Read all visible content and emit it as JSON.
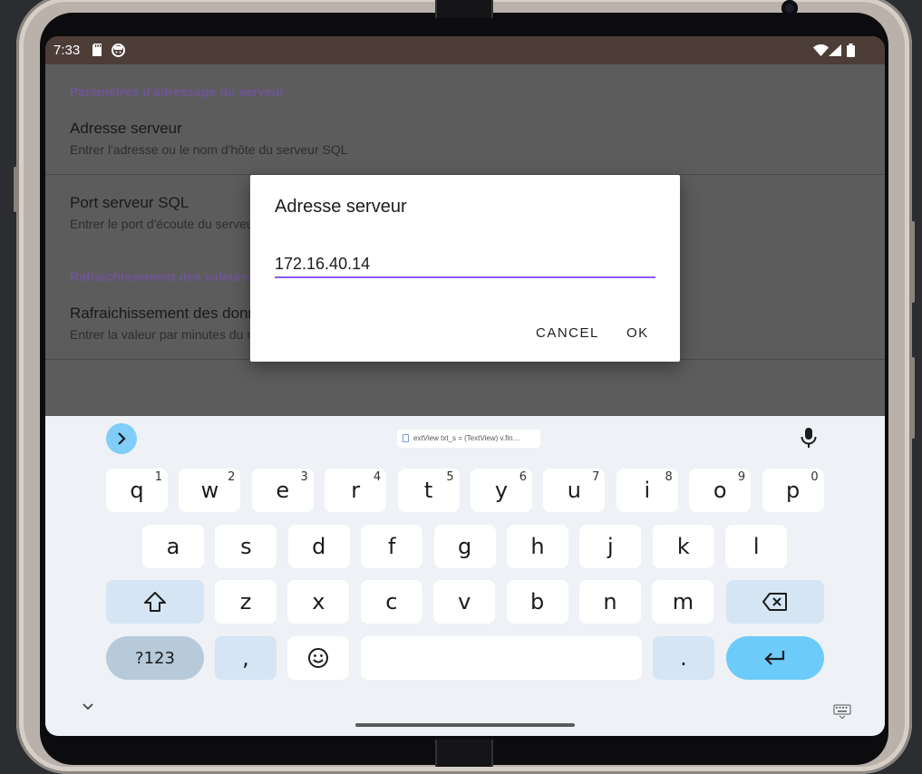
{
  "status_bar": {
    "time": "7:33",
    "icons": [
      "sd-card-icon",
      "smiley-notification-icon",
      "wifi-icon",
      "signal-icon",
      "battery-icon"
    ]
  },
  "settings": {
    "category_addressing": "Paramètres d'adressage du serveur",
    "server_address_title": "Adresse serveur",
    "server_address_summary": "Entrer l'adresse ou le nom d'hôte du serveur SQL",
    "sql_port_title": "Port serveur SQL",
    "sql_port_summary": "Entrer le port d'écoute du serveur SQL",
    "category_refresh": "Rafraichissement des valeurs",
    "refresh_title": "Rafraichissement des données",
    "refresh_summary": "Entrer la valeur par minutes du rafraichissement des données"
  },
  "dialog": {
    "title": "Adresse serveur",
    "input_value": "172.16.40.14",
    "cancel_label": "CANCEL",
    "ok_label": "OK"
  },
  "keyboard": {
    "clipboard_chip": "extView txt_s = (TextView) v.fin…",
    "row1": [
      {
        "key": "q",
        "hint": "1"
      },
      {
        "key": "w",
        "hint": "2"
      },
      {
        "key": "e",
        "hint": "3"
      },
      {
        "key": "r",
        "hint": "4"
      },
      {
        "key": "t",
        "hint": "5"
      },
      {
        "key": "y",
        "hint": "6"
      },
      {
        "key": "u",
        "hint": "7"
      },
      {
        "key": "i",
        "hint": "8"
      },
      {
        "key": "o",
        "hint": "9"
      },
      {
        "key": "p",
        "hint": "0"
      }
    ],
    "row2": [
      "a",
      "s",
      "d",
      "f",
      "g",
      "h",
      "j",
      "k",
      "l"
    ],
    "row3": [
      "z",
      "x",
      "c",
      "v",
      "b",
      "n",
      "m"
    ],
    "symbols_label": "?123",
    "comma_label": ",",
    "period_label": ".",
    "accent_color": "#6ccbf8"
  },
  "colors": {
    "category_text": "#6e5596",
    "input_underline": "#8b5cf6",
    "status_bar_bg": "#4d3d37"
  }
}
